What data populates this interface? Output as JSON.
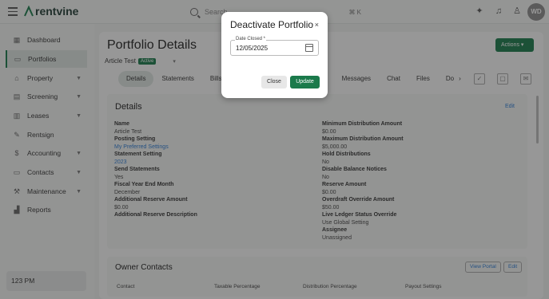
{
  "topbar": {
    "logo": "rentvine",
    "search_placeholder": "Search",
    "search_shortcut": "⌘ K",
    "avatar_initials": "WD"
  },
  "sidebar": {
    "items": [
      {
        "label": "Dashboard",
        "icon": "dashboard-icon"
      },
      {
        "label": "Portfolios",
        "icon": "portfolios-icon",
        "active": true
      },
      {
        "label": "Property",
        "icon": "property-icon",
        "expandable": true
      },
      {
        "label": "Screening",
        "icon": "screening-icon",
        "expandable": true
      },
      {
        "label": "Leases",
        "icon": "leases-icon",
        "expandable": true
      },
      {
        "label": "Rentsign",
        "icon": "rentsign-icon"
      },
      {
        "label": "Accounting",
        "icon": "dollar-icon",
        "expandable": true
      },
      {
        "label": "Contacts",
        "icon": "contacts-icon",
        "expandable": true
      },
      {
        "label": "Maintenance",
        "icon": "wrench-icon",
        "expandable": true
      },
      {
        "label": "Reports",
        "icon": "reports-icon"
      }
    ],
    "clock": "123 PM"
  },
  "main": {
    "title": "Portfolio Details",
    "actions_label": "Actions",
    "record_name": "Article Test",
    "record_status": "Active",
    "tabs": [
      "Details",
      "Statements",
      "Bills",
      "Messages",
      "Chat",
      "Files",
      "Do"
    ],
    "details": {
      "title": "Details",
      "edit_label": "Edit",
      "left_fields": [
        {
          "label": "Name",
          "value": "Article Test"
        },
        {
          "label": "Posting Setting",
          "value": "My Preferred Settings",
          "link": true
        },
        {
          "label": "Statement Setting",
          "value": "2023",
          "link": true
        },
        {
          "label": "Send Statements",
          "value": "Yes"
        },
        {
          "label": "Fiscal Year End Month",
          "value": "December"
        },
        {
          "label": "Additional Reserve Amount",
          "value": "$0.00"
        },
        {
          "label": "Additional Reserve Description",
          "value": ""
        }
      ],
      "right_fields": [
        {
          "label": "Minimum Distribution Amount",
          "value": "$0.00"
        },
        {
          "label": "Maximum Distribution Amount",
          "value": "$5,000.00"
        },
        {
          "label": "Hold Distributions",
          "value": "No"
        },
        {
          "label": "Disable Balance Notices",
          "value": "No"
        },
        {
          "label": "Reserve Amount",
          "value": "$0.00"
        },
        {
          "label": "Overdraft Override Amount",
          "value": "$50.00"
        },
        {
          "label": "Live Ledger Status Override",
          "value": "Use Global Setting"
        },
        {
          "label": "Assignee",
          "value": "Unassigned"
        }
      ]
    },
    "owner_contacts": {
      "title": "Owner Contacts",
      "view_portal_label": "View Portal",
      "edit_label": "Edit",
      "columns": [
        "Contact",
        "Taxable Percentage",
        "Distribution Percentage",
        "Payout Settings"
      ]
    }
  },
  "modal": {
    "title": "Deactivate Portfolio",
    "close_symbol": "×",
    "date_label": "Date Closed *",
    "date_value": "12/05/2025",
    "close_button": "Close",
    "update_button": "Update"
  }
}
